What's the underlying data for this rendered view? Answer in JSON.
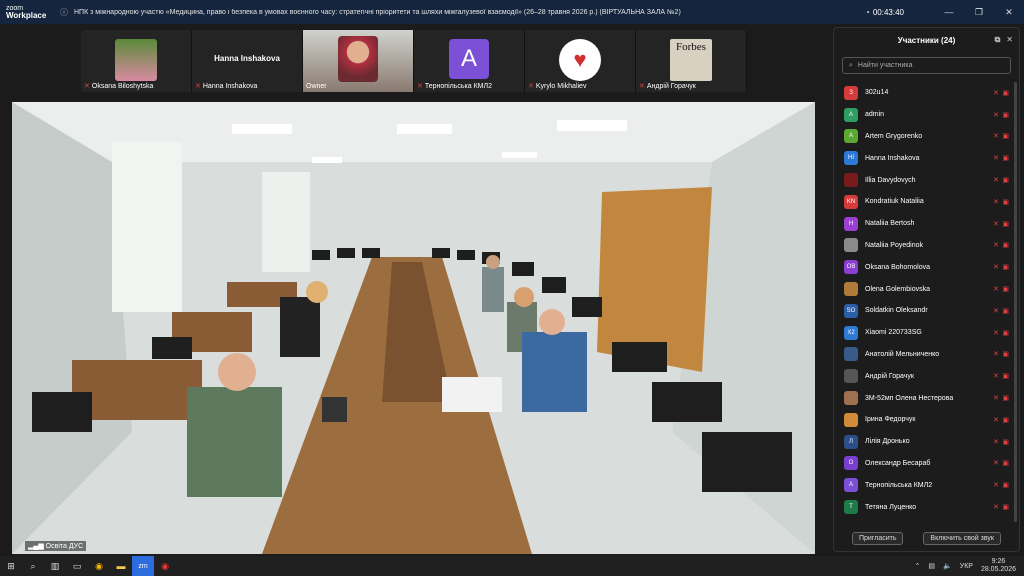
{
  "app": {
    "logo_line1": "zoom",
    "logo_line2": "Workplace",
    "title": "НПК з міжнародною участю «Медицина, право і безпека в умовах воєнного часу: стратегічні пріоритети та шляхи міжгалузевої взаємодії» (26–28 травня 2026 р.) (ВІРТУАЛЬНА ЗАЛА №2)",
    "timer": "00:43:40"
  },
  "tiles": [
    {
      "name": "Oksana Biloshytska",
      "kind": "photo"
    },
    {
      "name": "Hanna Inshakova",
      "big": "Hanna Inshakova",
      "kind": "text"
    },
    {
      "name": "Owner",
      "kind": "video"
    },
    {
      "name": "Тернопільська КМЛ2",
      "avatar": "A",
      "kind": "avatar"
    },
    {
      "name": "Kyrylo Mikhaliev",
      "kind": "logo"
    },
    {
      "name": "Андрій Горачук",
      "big": "Forbes",
      "kind": "forbes"
    }
  ],
  "video": {
    "label": "Освіта ДУС"
  },
  "panel": {
    "title": "Участники (24)",
    "search_placeholder": "Найти участника",
    "invite": "Пригласить",
    "unmute": "Включить свой звук",
    "participants": [
      {
        "initials": "З",
        "name": "302u14",
        "color": "#d63b3b"
      },
      {
        "initials": "A",
        "name": "admin",
        "color": "#2f9e62"
      },
      {
        "initials": "A",
        "name": "Artem Grygorenko",
        "color": "#5aa832"
      },
      {
        "initials": "HI",
        "name": "Hanna Inshakova",
        "color": "#2d7ad6"
      },
      {
        "initials": "",
        "name": "Illia Davydovych",
        "color": "#7a1b1b"
      },
      {
        "initials": "KN",
        "name": "Kondratiuk Nataliia",
        "color": "#d63b3b"
      },
      {
        "initials": "H",
        "name": "Nataliia Bertosh",
        "color": "#9b3fd1"
      },
      {
        "initials": "",
        "name": "Nataliia Poyedinok",
        "color": "#8a8a8a"
      },
      {
        "initials": "OB",
        "name": "Oksana Bohomolova",
        "color": "#8a3fd1"
      },
      {
        "initials": "",
        "name": "Olena Golembiovska",
        "color": "#b07a3a"
      },
      {
        "initials": "SO",
        "name": "Soldatkin Oleksandr",
        "color": "#2a5fa8"
      },
      {
        "initials": "X2",
        "name": "Xiaomi 220733SG",
        "color": "#2d7ad6"
      },
      {
        "initials": "",
        "name": "Анатолій Мельниченко",
        "color": "#3a5a8a"
      },
      {
        "initials": "",
        "name": "Андрій Горачук",
        "color": "#555555"
      },
      {
        "initials": "",
        "name": "3М-52мп Олена Нестерова",
        "color": "#a07050"
      },
      {
        "initials": "",
        "name": "Ірина Федорчук",
        "color": "#d08a3a"
      },
      {
        "initials": "Л",
        "name": "Лілія Дронько",
        "color": "#2a4f8a"
      },
      {
        "initials": "О",
        "name": "Олександр Бесараб",
        "color": "#7a3fd1"
      },
      {
        "initials": "A",
        "name": "Тернопільська КМЛ2",
        "color": "#7b4fd6"
      },
      {
        "initials": "Т",
        "name": "Тетяна Луценко",
        "color": "#1f7a4a"
      }
    ]
  },
  "taskbar": {
    "lang": "УКР",
    "time": "9:26",
    "date": "28.05.2026"
  }
}
